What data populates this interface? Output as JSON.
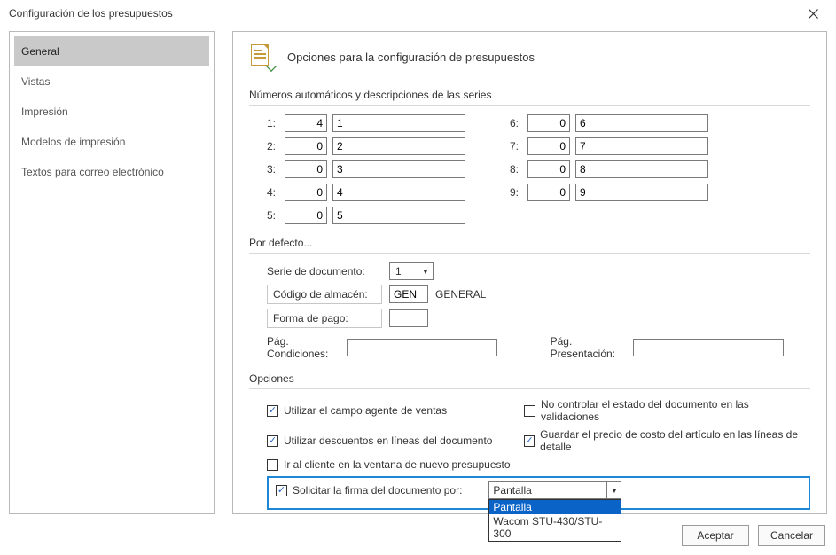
{
  "window": {
    "title": "Configuración de los presupuestos"
  },
  "nav": {
    "items": [
      {
        "label": "General"
      },
      {
        "label": "Vistas"
      },
      {
        "label": "Impresión"
      },
      {
        "label": "Modelos de impresión"
      },
      {
        "label": "Textos para correo electrónico"
      }
    ]
  },
  "header": {
    "title": "Opciones para la configuración de presupuestos"
  },
  "section_series": {
    "title": "Números automáticos y descripciones de las series",
    "rows": [
      {
        "key": "1:",
        "num": "4",
        "desc": "1"
      },
      {
        "key": "2:",
        "num": "0",
        "desc": "2"
      },
      {
        "key": "3:",
        "num": "0",
        "desc": "3"
      },
      {
        "key": "4:",
        "num": "0",
        "desc": "4"
      },
      {
        "key": "5:",
        "num": "0",
        "desc": "5"
      },
      {
        "key": "6:",
        "num": "0",
        "desc": "6"
      },
      {
        "key": "7:",
        "num": "0",
        "desc": "7"
      },
      {
        "key": "8:",
        "num": "0",
        "desc": "8"
      },
      {
        "key": "9:",
        "num": "0",
        "desc": "9"
      }
    ]
  },
  "section_defaults": {
    "title": "Por defecto...",
    "serie_label": "Serie de documento:",
    "serie_value": "1",
    "codigo_label": "Código de almacén:",
    "codigo_value": "GEN",
    "codigo_desc": "GENERAL",
    "forma_label": "Forma de pago:",
    "forma_value": "",
    "condiciones_label": "Pág. Condiciones:",
    "presentacion_label": "Pág. Presentación:"
  },
  "section_options": {
    "title": "Opciones",
    "opt1": {
      "label": "Utilizar el campo agente de ventas",
      "checked": true
    },
    "opt2": {
      "label": "No controlar el estado del documento en las validaciones",
      "checked": false
    },
    "opt3": {
      "label": "Utilizar descuentos en líneas del documento",
      "checked": true
    },
    "opt4": {
      "label": "Guardar el precio de costo del artículo en las líneas de detalle",
      "checked": true
    },
    "opt5": {
      "label": "Ir al cliente en la ventana de nuevo presupuesto",
      "checked": false
    },
    "signature": {
      "label": "Solicitar la firma del documento por:",
      "checked": true,
      "value": "Pantalla",
      "options": [
        "Pantalla",
        "Wacom STU-430/STU-300"
      ]
    }
  },
  "buttons": {
    "accept": "Aceptar",
    "cancel": "Cancelar"
  }
}
